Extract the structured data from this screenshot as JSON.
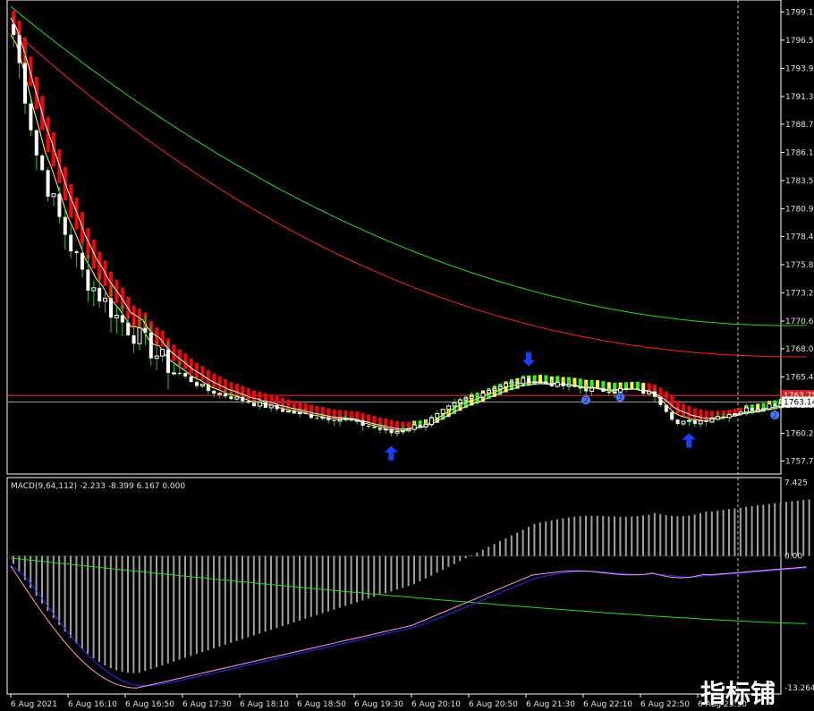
{
  "chart_data": {
    "type": "candlestick",
    "main": {
      "ylim": [
        1756.5,
        1800.2
      ],
      "yticks": [
        "1799.10",
        "1796.50",
        "1793.90",
        "1791.30",
        "1788.75",
        "1786.15",
        "1783.55",
        "1780.95",
        "1778.40",
        "1775.80",
        "1773.20",
        "1770.60",
        "1768.05",
        "1765.45",
        "1762.85",
        "1760.25",
        "1757.70"
      ],
      "price_tags": [
        {
          "text": "1763.75",
          "value": 1763.75,
          "color": "#d02020"
        },
        {
          "text": "1763.14",
          "value": 1763.14,
          "color": "#ffffff"
        }
      ],
      "hlines": [
        {
          "value": 1763.75,
          "color": "#ff2a2a"
        },
        {
          "value": 1763.14,
          "color": "#9a9a9a"
        }
      ]
    },
    "macd": {
      "label": "MACD(9,64,112) -2.233 -8.399 6.167 0.000",
      "ylim": [
        -13.9,
        7.9
      ],
      "yticks": [
        "7.425",
        "0.00",
        "-13.264"
      ],
      "series_colors": {
        "histogram": "#a0a0a0",
        "line": "#ff9bd2",
        "signal": "#2b2bff",
        "slow": "#22dd22"
      }
    },
    "x_tick_labels": [
      "6 Aug 2021",
      "6 Aug 16:10",
      "6 Aug 16:50",
      "6 Aug 17:30",
      "6 Aug 18:10",
      "6 Aug 18:50",
      "6 Aug 19:30",
      "6 Aug 20:10",
      "6 Aug 20:50",
      "6 Aug 21:30",
      "6 Aug 22:10",
      "6 Aug 22:50",
      "6 Aug 23:30"
    ],
    "markers": [
      {
        "type": "arrow-down",
        "bar": 90,
        "color": "#1a3dff"
      },
      {
        "type": "arrow-up",
        "bar": 66,
        "color": "#1a3dff"
      },
      {
        "type": "arrow-up",
        "bar": 118,
        "color": "#1a3dff"
      },
      {
        "type": "circle-label",
        "bar": 100,
        "label": "2",
        "color": "#4a78ff"
      },
      {
        "type": "circle-label",
        "bar": 106,
        "label": "3",
        "color": "#4a78ff"
      },
      {
        "type": "circle-label",
        "bar": 133,
        "label": "2",
        "color": "#4a78ff"
      }
    ],
    "colors": {
      "bull_candle": "#ffffff",
      "bear_candle": "#ffffff",
      "wick": "#22cc22",
      "ema_fast": "#ffff66",
      "ema_mid": "#ffffff",
      "ma_red": "#ff2020",
      "ma_green": "#19e019",
      "band_bear": "#ff0000",
      "band_bull_a": "#22ff22",
      "band_bull_b": "#ffff22"
    }
  },
  "watermark": "指标铺"
}
